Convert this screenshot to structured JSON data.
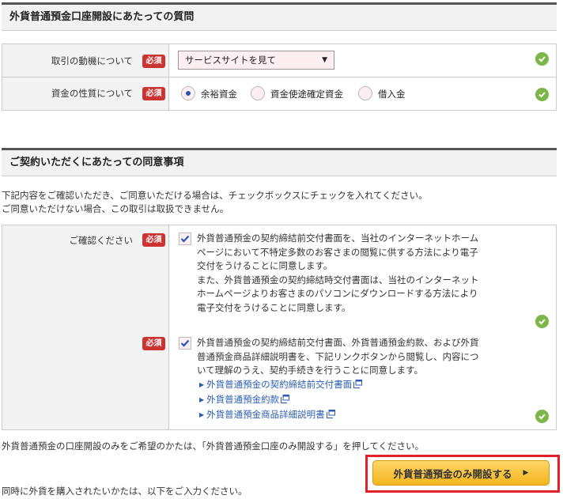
{
  "section1": {
    "title": "外貨普通預金口座開設にあたっての質問",
    "motive": {
      "label": "取引の動機について",
      "required": "必須",
      "selected": "サービスサイトを見て"
    },
    "funds": {
      "label": "資金の性質について",
      "required": "必須",
      "options": [
        {
          "label": "余裕資金",
          "checked": true
        },
        {
          "label": "資金使途確定資金",
          "checked": false
        },
        {
          "label": "借入金",
          "checked": false
        }
      ]
    }
  },
  "section2": {
    "title": "ご契約いただくにあたっての同意事項",
    "intro": [
      "下記内容をご確認いただき、ご同意いただける場合は、チェックボックスにチェックを入れてください。",
      "ご同意いただけない場合、この取引は取扱できません。"
    ],
    "confirm_label": "ご確認ください",
    "required": "必須",
    "consent1": {
      "checked": true,
      "lines": [
        "外貨普通預金の契約締結前交付書面を、当社のインターネットホーム",
        "ページにおいて不特定多数のお客さまの閲覧に供する方法により電子",
        "交付をうけることに同意します。",
        "また、外貨普通預金の契約締結時交付書面は、当社のインターネット",
        "ホームページよりお客さまのパソコンにダウンロードする方法により",
        "電子交付をうけることに同意します。"
      ]
    },
    "consent2": {
      "checked": true,
      "lines": [
        "外貨普通預金の契約締結前交付書面、外貨普通預金約款、および外貨",
        "普通預金商品詳細説明書を、下記リンクボタンから閲覧し、内容につ",
        "いて理解のうえ、契約手続きを行うことに同意します。"
      ],
      "links": [
        "外貨普通預金の契約締結前交付書面",
        "外貨普通預金約款",
        "外貨普通預金商品詳細説明書"
      ]
    }
  },
  "footer": {
    "note1": "外貨普通預金の口座開設のみをご希望のかたは、「外貨普通預金口座のみ開設する」を押してください。",
    "button": "外貨普通預金のみ開設する",
    "note2": "同時に外貨を購入されたいかたは、以下をご入力ください。"
  },
  "colors": {
    "required_badge": "#cc3333",
    "ok_check": "#7ab648",
    "link": "#2a5db0",
    "button": "#f3b51d",
    "highlight_frame": "#e2202a"
  }
}
